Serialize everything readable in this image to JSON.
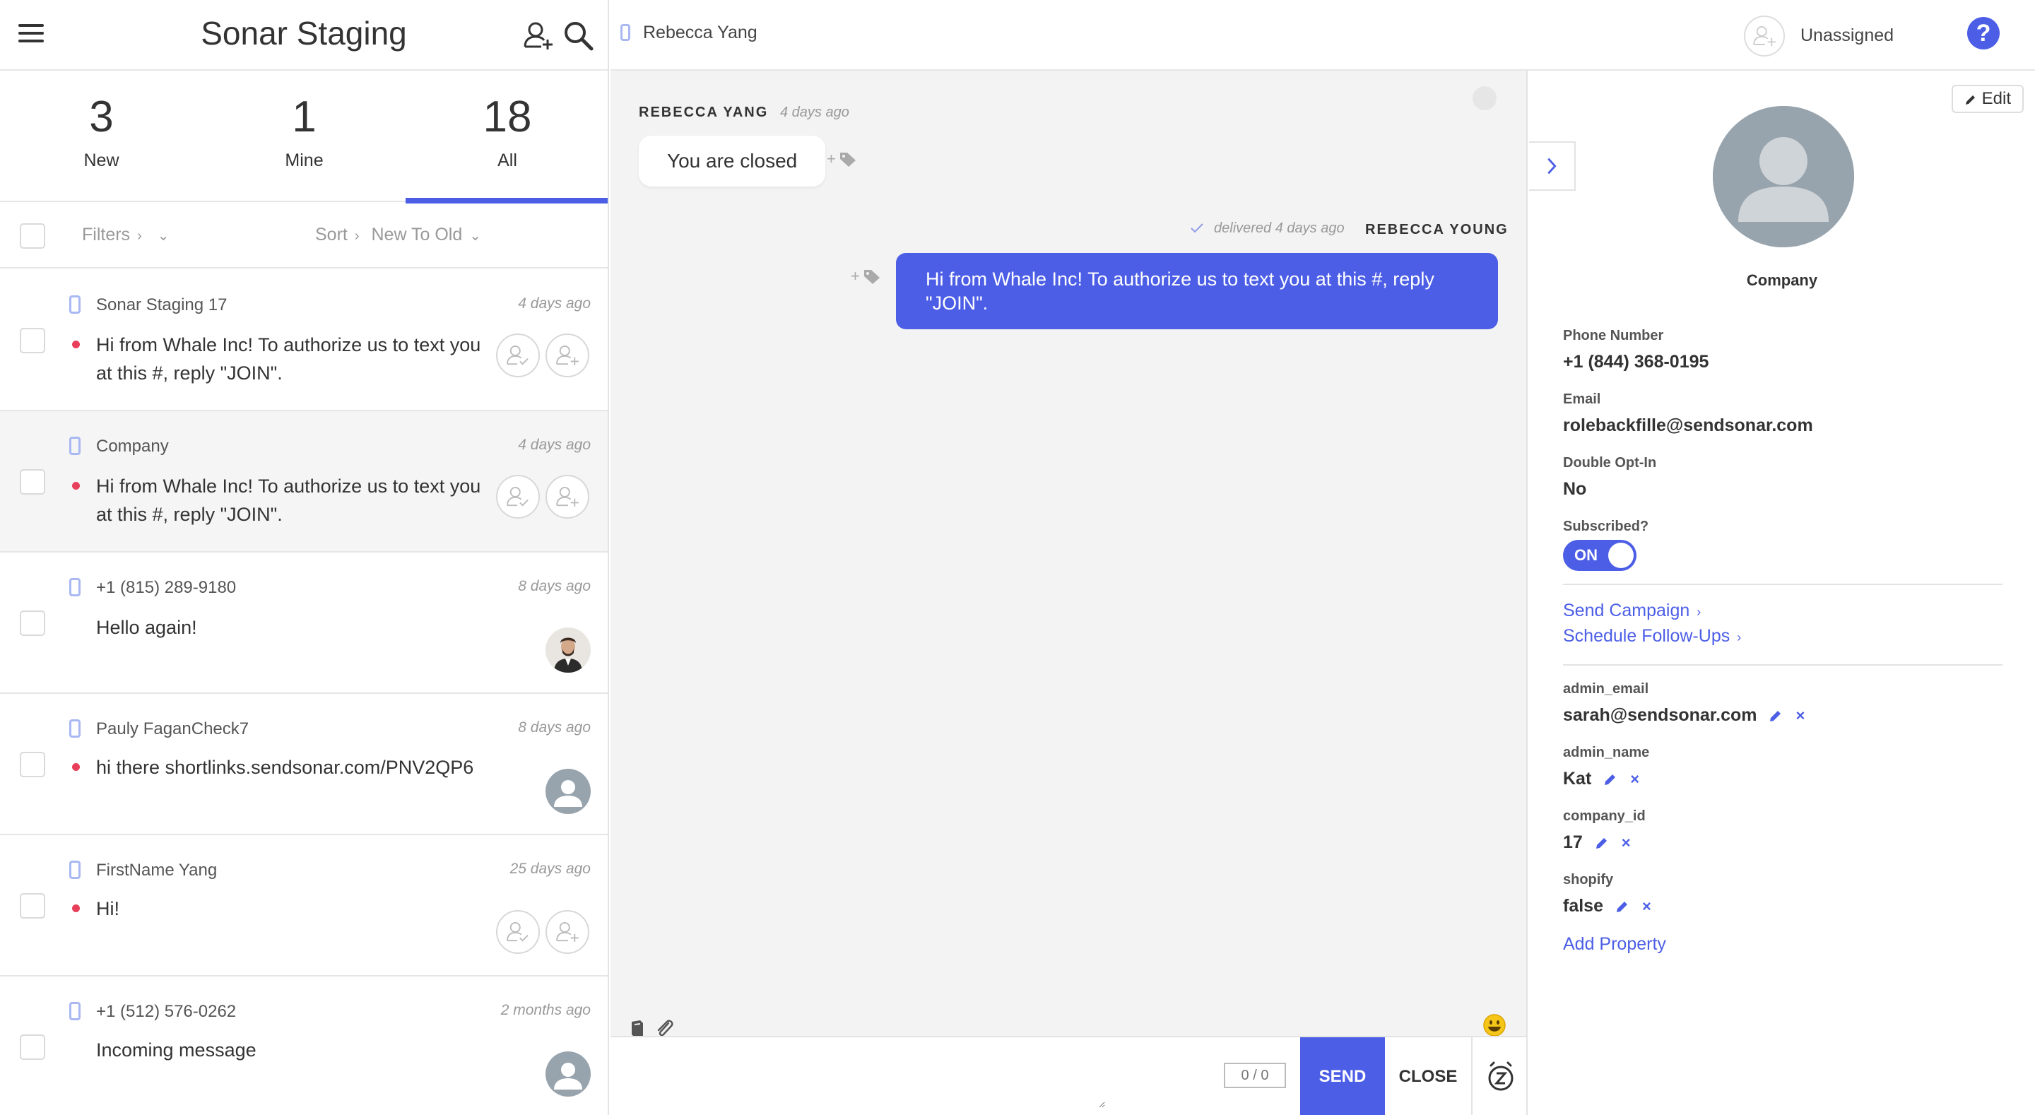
{
  "app": {
    "title": "Sonar Staging"
  },
  "counters": [
    {
      "count": "3",
      "label": "New"
    },
    {
      "count": "1",
      "label": "Mine"
    },
    {
      "count": "18",
      "label": "All"
    }
  ],
  "filters": {
    "filters_label": "Filters",
    "sort_label": "Sort",
    "sort_value": "New To Old"
  },
  "conversations": [
    {
      "name": "Sonar Staging 17",
      "time": "4 days ago",
      "message": "Hi from Whale Inc! To authorize us to text you at this #, reply \"JOIN\".",
      "unread": true
    },
    {
      "name": "Company",
      "time": "4 days ago",
      "message": "Hi from Whale Inc! To authorize us to text you at this #, reply \"JOIN\".",
      "unread": true
    },
    {
      "name": "+1 (815) 289-9180",
      "time": "8 days ago",
      "message": "Hello again!",
      "unread": false
    },
    {
      "name": "Pauly FaganCheck7",
      "time": "8 days ago",
      "message": "hi there shortlinks.sendsonar.com/PNV2QP6",
      "unread": true
    },
    {
      "name": "FirstName Yang",
      "time": "25 days ago",
      "message": "Hi!",
      "unread": true
    },
    {
      "name": "+1 (512) 576-0262",
      "time": "2 months ago",
      "message": "Incoming message",
      "unread": false
    }
  ],
  "header": {
    "contact_name": "Rebecca Yang",
    "assignee": "Unassigned",
    "help": "?"
  },
  "chat": {
    "incoming": {
      "sender": "REBECCA YANG",
      "time": "4 days ago",
      "text": "You are closed"
    },
    "outgoing": {
      "status": "delivered 4 days ago",
      "sender": "REBECCA YOUNG",
      "text": "Hi from Whale Inc! To authorize us to text you at this #, reply \"JOIN\"."
    },
    "tag_add": "+"
  },
  "composer": {
    "placeholder": "",
    "char_count": "0 / 0",
    "send": "SEND",
    "close": "CLOSE"
  },
  "details": {
    "edit": "Edit",
    "company": "Company",
    "phone_label": "Phone Number",
    "phone": "+1 (844) 368-0195",
    "email_label": "Email",
    "email": "rolebackfille@sendsonar.com",
    "optin_label": "Double Opt-In",
    "optin": "No",
    "subscribed_label": "Subscribed?",
    "subscribed": "ON",
    "send_campaign": "Send Campaign",
    "schedule_followups": "Schedule Follow-Ups",
    "properties": [
      {
        "key": "admin_email",
        "value": "sarah@sendsonar.com"
      },
      {
        "key": "admin_name",
        "value": "Kat"
      },
      {
        "key": "company_id",
        "value": "17"
      },
      {
        "key": "shopify",
        "value": "false"
      }
    ],
    "add_property": "Add Property"
  },
  "colors": {
    "accent": "#4c5ee6",
    "unread": "#e8405a"
  }
}
